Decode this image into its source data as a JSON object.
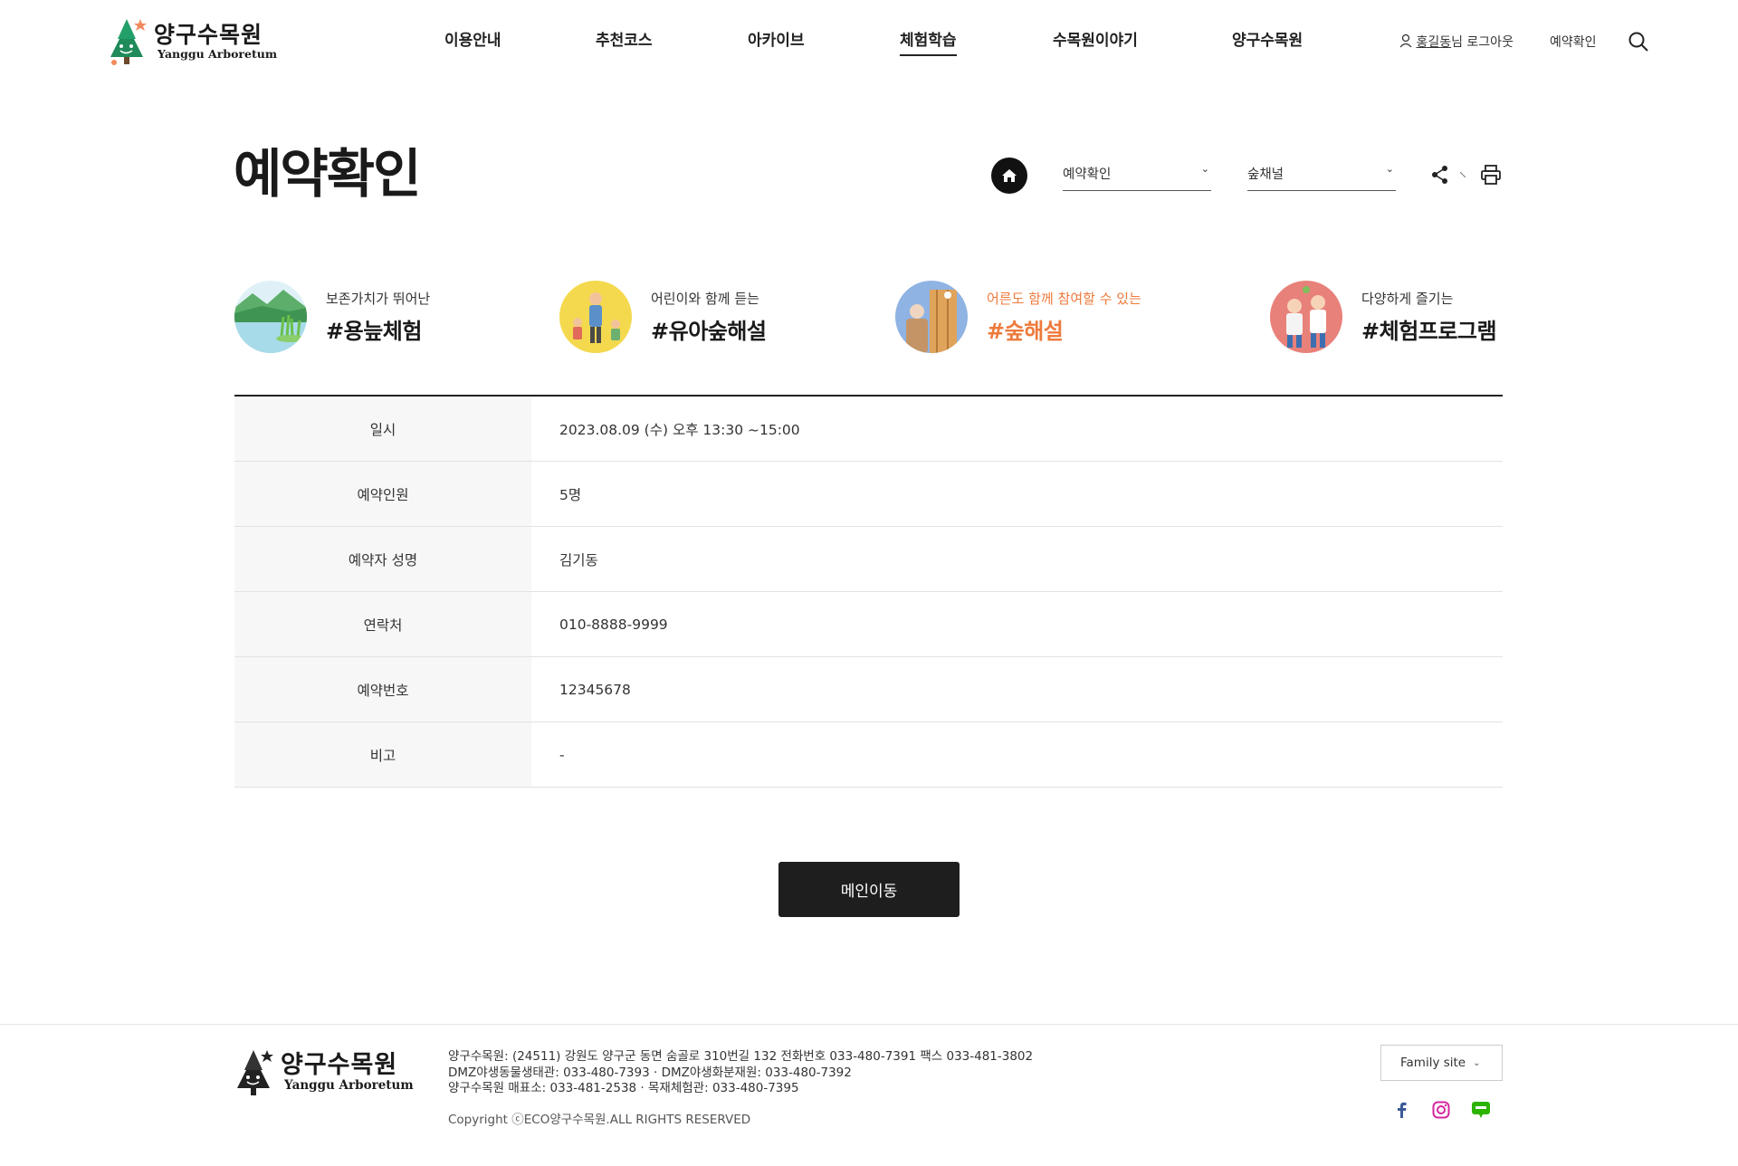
{
  "header": {
    "logo_ko": "양구수목원",
    "logo_en": "Yanggu Arboretum",
    "nav": [
      {
        "label": "이용안내"
      },
      {
        "label": "추천코스"
      },
      {
        "label": "아카이브"
      },
      {
        "label": "체험학습",
        "active": true
      },
      {
        "label": "수목원이야기"
      },
      {
        "label": "양구수목원"
      }
    ],
    "user_name": "홍길동",
    "user_suffix": "님 로그아웃",
    "reservation_link": "예약확인"
  },
  "page": {
    "title": "예약확인",
    "select1": "예약확인",
    "select2": "숲채널"
  },
  "programs": [
    {
      "sub": "보존가치가 뛰어난",
      "tag": "#용늪체험"
    },
    {
      "sub": "어린이와 함께 듣는",
      "tag": "#유아숲해설"
    },
    {
      "sub": "어른도 함께 참여할 수 있는",
      "tag": "#숲해설",
      "highlight": true
    },
    {
      "sub": "다양하게 즐기는",
      "tag": "#체험프로그램"
    }
  ],
  "reservation": {
    "rows": [
      {
        "label": "일시",
        "value": "2023.08.09 (수) 오후 13:30 ~15:00"
      },
      {
        "label": "예약인원",
        "value": "5명"
      },
      {
        "label": "예약자 성명",
        "value": "김기동"
      },
      {
        "label": "연락처",
        "value": "010-8888-9999"
      },
      {
        "label": "예약번호",
        "value": "12345678"
      },
      {
        "label": "비고",
        "value": "-"
      }
    ]
  },
  "main_button": "메인이동",
  "footer": {
    "logo_ko": "양구수목원",
    "logo_en": "Yanggu Arboretum",
    "line1": "양구수목원: (24511) 강원도 양구군 동면 숨골로 310번길 132 전화번호 033-480-7391 팩스 033-481-3802",
    "line2": "DMZ야생동물생태관: 033-480-7393 · DMZ야생화분재원: 033-480-7392",
    "line3": "양구수목원 매표소: 033-481-2538 · 목재체험관: 033-480-7395",
    "copyright": "Copyright ⓒECO양구수목원.ALL RIGHTS RESERVED",
    "family_site": "Family site",
    "sns": [
      "facebook-icon",
      "instagram-icon",
      "blog-icon"
    ]
  },
  "colors": {
    "accent_orange": "#ee7a3c",
    "dark": "#1e1e1e",
    "logo_green": "#1f8a5a",
    "logo_star": "#f08a5d"
  }
}
